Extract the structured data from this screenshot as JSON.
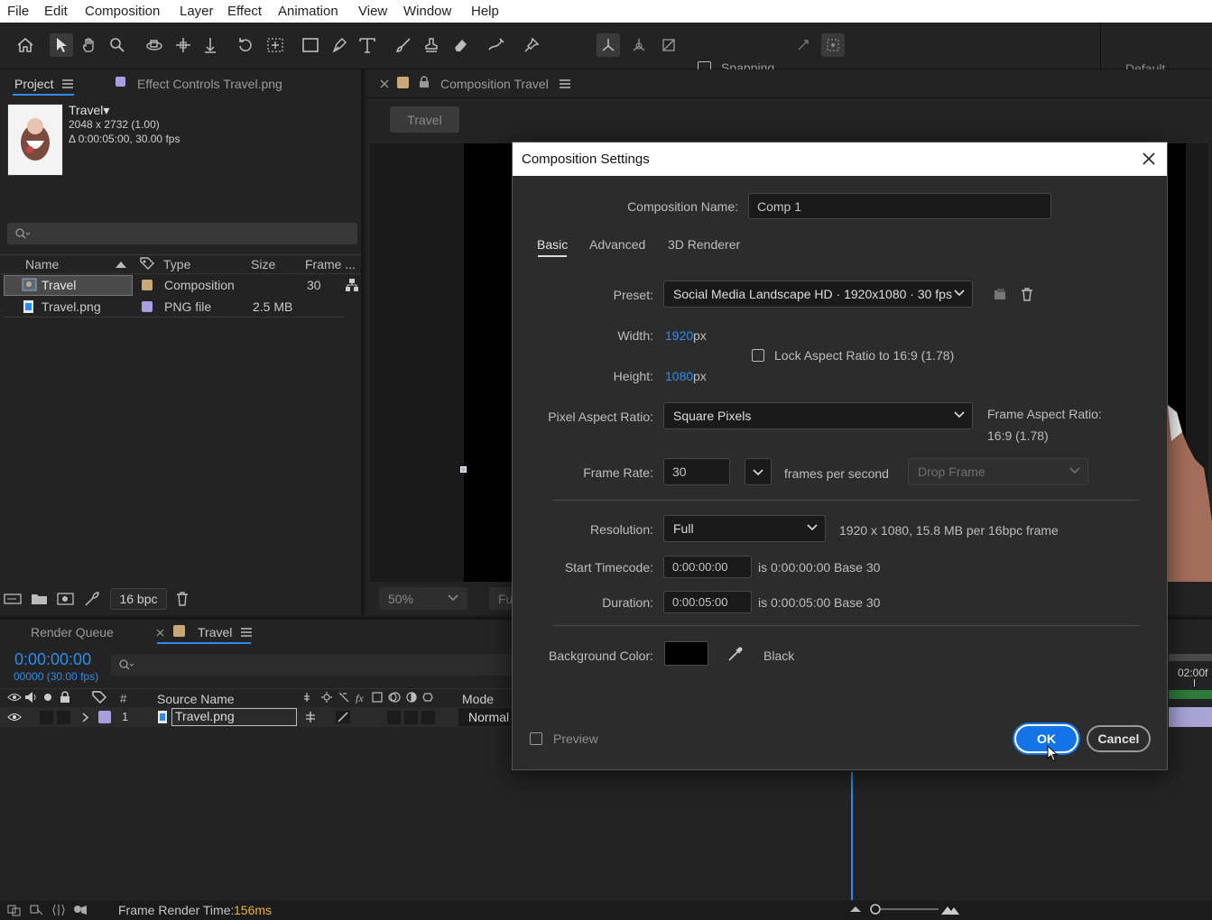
{
  "menu": [
    "File",
    "Edit",
    "Composition",
    "Layer",
    "Effect",
    "Animation",
    "View",
    "Window",
    "Help"
  ],
  "toolbar": {
    "snapping_label": "Snapping",
    "workspace": "Default"
  },
  "project_panel": {
    "tab_project": "Project",
    "tab_effect_controls": "Effect Controls Travel.png",
    "item_name": "Travel▾",
    "item_dims": "2048 x 2732 (1.00)",
    "item_duration": "Δ 0:00:05:00, 30.00 fps",
    "search_placeholder": "",
    "columns": {
      "name": "Name",
      "type": "Type",
      "size": "Size",
      "frame": "Frame ..."
    },
    "rows": [
      {
        "name": "Travel",
        "type": "Composition",
        "size": "",
        "frame": "30",
        "label_color": "#c9a878"
      },
      {
        "name": "Travel.png",
        "type": "PNG file",
        "size": "2.5 MB",
        "frame": "",
        "label_color": "#a89ee0"
      }
    ],
    "bpc": "16 bpc"
  },
  "viewer": {
    "tab_title": "Composition Travel",
    "comp_chip": "Travel",
    "zoom": "50%",
    "res_partial": "Fu"
  },
  "timeline": {
    "tab_render_queue": "Render Queue",
    "tab_travel": "Travel",
    "timecode": "0:00:00:00",
    "frames": "00000 (30.00 fps)",
    "col_hash": "#",
    "col_source": "Source Name",
    "col_mode": "Mode",
    "layer_num": "1",
    "layer_name": "Travel.png",
    "layer_mode": "Normal",
    "ruler_label": "02:00f"
  },
  "status": {
    "render_time_label": "Frame Render Time:",
    "render_time_value": "156ms"
  },
  "dialog": {
    "title": "Composition Settings",
    "comp_name_label": "Composition Name:",
    "comp_name_value": "Comp 1",
    "tabs": [
      "Basic",
      "Advanced",
      "3D Renderer"
    ],
    "preset_label": "Preset:",
    "preset_value": "Social Media Landscape HD  ·  1920x1080 · 30 fps",
    "width_label": "Width:",
    "width_value": "1920",
    "height_label": "Height:",
    "height_value": "1080",
    "px": "px",
    "lock_aspect_label": "Lock Aspect Ratio to 16:9 (1.78)",
    "pixel_aspect_label": "Pixel Aspect Ratio:",
    "pixel_aspect_value": "Square Pixels",
    "frame_aspect_label": "Frame Aspect Ratio:",
    "frame_aspect_value": "16:9 (1.78)",
    "frame_rate_label": "Frame Rate:",
    "frame_rate_value": "30",
    "fps_suffix": "frames per second",
    "drop_frame": "Drop Frame",
    "resolution_label": "Resolution:",
    "resolution_value": "Full",
    "resolution_info": "1920 x 1080, 15.8 MB per 16bpc frame",
    "start_tc_label": "Start Timecode:",
    "start_tc_value": "0:00:00:00",
    "start_tc_info": "is 0:00:00:00  Base 30",
    "duration_label": "Duration:",
    "duration_value": "0:00:05:00",
    "duration_info": "is 0:00:05:00  Base 30",
    "bg_color_label": "Background Color:",
    "bg_color_name": "Black",
    "bg_color_hex": "#000000",
    "preview_label": "Preview",
    "ok": "OK",
    "cancel": "Cancel"
  },
  "colors": {
    "accent_blue": "#2d8ceb",
    "ok_button": "#1473e6",
    "timecode": "#2d8ceb",
    "render_time": "#e8b33a"
  }
}
